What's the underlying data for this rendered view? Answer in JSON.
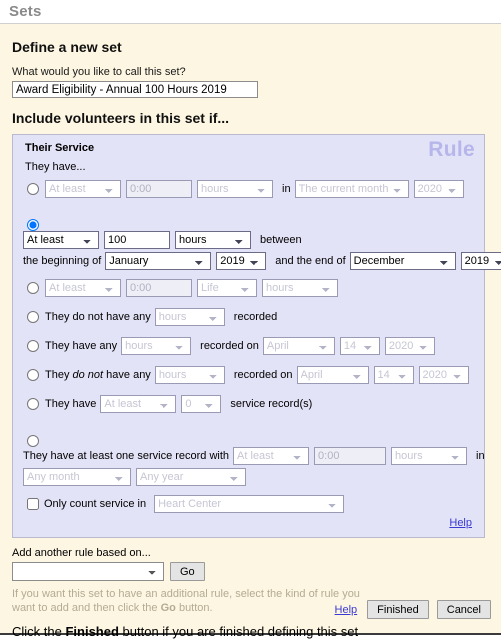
{
  "window": {
    "title": "Sets"
  },
  "page": {
    "heading": "Define a new set",
    "name_label": "What would you like to call this set?",
    "name_value": "Award Eligibility - Annual 100 Hours 2019",
    "include_heading": "Include volunteers in this set if..."
  },
  "rule": {
    "watermark": "Rule",
    "title": "Their Service",
    "intro": "They have...",
    "help_label": "Help",
    "options": {
      "at_least": "At least",
      "hours": "hours",
      "time_zero": "0:00",
      "life": "Life",
      "current_month": "The current month",
      "any_month": "Any month",
      "any_year": "Any year",
      "january": "January",
      "december": "December",
      "april": "April",
      "year_2019": "2019",
      "year_2020": "2020",
      "day_14": "14",
      "count_zero": "0",
      "heart_center": "Heart Center"
    },
    "rows": {
      "r1": {
        "in_label": "in"
      },
      "r2": {
        "between_label": "between",
        "beginning_label": "the beginning of",
        "end_label": "and the end of",
        "amount": "100"
      },
      "r4": {
        "prefix": "They do not have any",
        "suffix": "recorded"
      },
      "r5": {
        "prefix": "They have any",
        "suffix": "recorded on"
      },
      "r6": {
        "prefix_a": "They ",
        "prefix_em": "do not",
        "prefix_b": " have any",
        "suffix": "recorded on"
      },
      "r7": {
        "prefix": "They have",
        "suffix": "service record(s)"
      },
      "r8": {
        "prefix": "They have at least one service record with",
        "in_label": "in"
      }
    },
    "only_count_label": "Only count service in"
  },
  "bottom": {
    "add_rule_label": "Add another rule based on...",
    "add_rule_value": "",
    "go_label": "Go",
    "hint_a": "If you want this set to have an additional rule, select the kind of rule you want to add and then click the ",
    "hint_b": "Go",
    "hint_c": " button.",
    "finish_a": "Click the ",
    "finish_b": "Finished",
    "finish_c": " button if you are finished defining this set",
    "help_label": "Help",
    "finished_label": "Finished",
    "cancel_label": "Cancel"
  }
}
